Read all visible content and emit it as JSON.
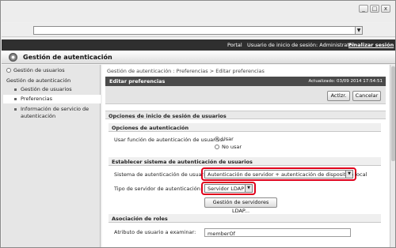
{
  "window": {
    "controls": [
      "_",
      "□",
      "x"
    ]
  },
  "topbar": {
    "portal": "Portal",
    "user_label": "Usuario de inicio de sesión: Administrator",
    "logout": "Finalizar sesión"
  },
  "header": {
    "title": "Gestión de autenticación"
  },
  "sidebar": {
    "top_item": "Gestión de usuarios",
    "section": "Gestión de autenticación",
    "items": [
      {
        "label": "Gestión de usuarios"
      },
      {
        "label": "Preferencias"
      },
      {
        "label_line1": "Información de servicio de",
        "label_line2": "autenticación"
      }
    ]
  },
  "main": {
    "breadcrumb": "Gestión de autenticación : Preferencias > Editar preferencias",
    "page_title": "Editar preferencias",
    "updated": "Actualizado: 03/09 2014 17:54:51",
    "apply_button": "Actlzr.",
    "cancel_button": "Cancelar",
    "section_title": "Opciones de inicio de sesión de usuarios",
    "auth_options": {
      "title": "Opciones de autenticación",
      "label": "Usar función de autenticación de usuarios:",
      "options": [
        "Usar",
        "No usar"
      ],
      "selected": "Usar"
    },
    "auth_system": {
      "title": "Establecer sistema de autenticación de usuarios",
      "system_label": "Sistema de autenticación de usuarios:",
      "system_value": "Autenticación de servidor + autenticación de dispositivo local",
      "server_type_label": "Tipo de servidor de autenticación:",
      "server_type_value": "Servidor LDAP",
      "ldap_button": "Gestión de servidores LDAP..."
    },
    "role_assoc": {
      "title": "Asociación de roles",
      "attr_label": "Atributo de usuario a examinar:",
      "attr_value": "memberOf"
    }
  },
  "colors": {
    "highlight": "#e0001b",
    "topbar": "#2f2f2f",
    "pagebar": "#4a4a4a"
  }
}
